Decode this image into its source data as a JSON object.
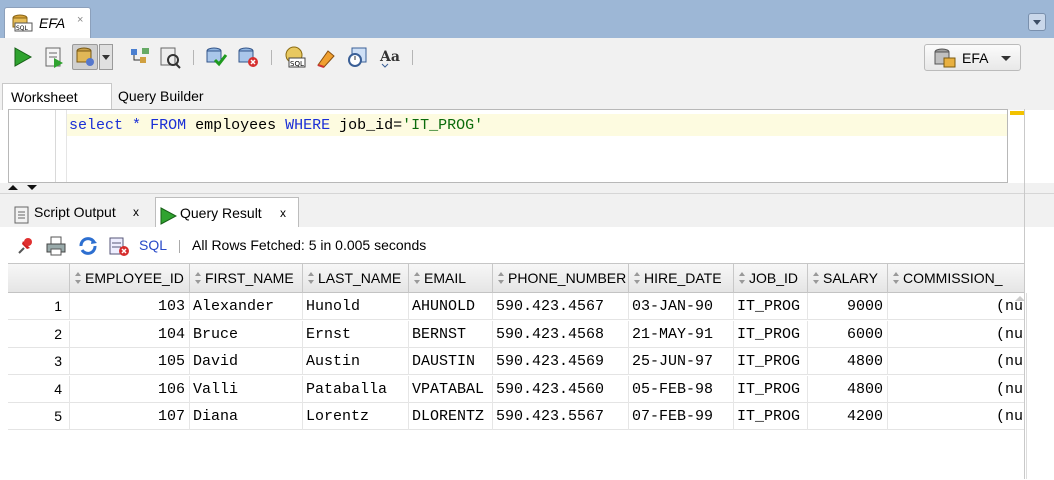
{
  "document_tab": {
    "title": "EFA",
    "close": "×",
    "icon": "sql-worksheet-icon"
  },
  "toolbar": {
    "connection_label": "EFA",
    "icons": [
      "run-statement-icon",
      "run-script-icon",
      "autotrace-icon",
      "dropdown-arrow-icon",
      "explain-plan-icon",
      "sql-tuning-icon",
      "commit-icon",
      "rollback-icon",
      "sql-history-icon",
      "clear-icon",
      "unshared-worksheet-icon",
      "format-case-icon"
    ]
  },
  "worksheet_tabs": {
    "worksheet": "Worksheet",
    "query_builder": "Query Builder"
  },
  "editor": {
    "tokens": [
      {
        "t": "select",
        "c": "kw"
      },
      {
        "t": " ",
        "c": ""
      },
      {
        "t": "*",
        "c": "kw"
      },
      {
        "t": " ",
        "c": ""
      },
      {
        "t": "FROM",
        "c": "kw"
      },
      {
        "t": " employees ",
        "c": ""
      },
      {
        "t": "WHERE",
        "c": "kw"
      },
      {
        "t": " job_id=",
        "c": ""
      },
      {
        "t": "'IT_PROG'",
        "c": "str"
      }
    ]
  },
  "output_tabs": {
    "script_output": "Script Output",
    "query_result": "Query Result",
    "close": "x"
  },
  "result_toolbar": {
    "sql_link": "SQL",
    "status": "All Rows Fetched: 5 in 0.005 seconds",
    "icons": [
      "pin-icon",
      "print-icon",
      "refresh-icon",
      "export-icon"
    ]
  },
  "grid": {
    "columns": [
      "EMPLOYEE_ID",
      "FIRST_NAME",
      "LAST_NAME",
      "EMAIL",
      "PHONE_NUMBER",
      "HIRE_DATE",
      "JOB_ID",
      "SALARY",
      "COMMISSION_"
    ],
    "rows": [
      {
        "n": "1",
        "cells": [
          "103",
          "Alexander",
          "Hunold",
          "AHUNOLD",
          "590.423.4567",
          "03-JAN-90",
          "IT_PROG",
          "9000",
          "(nu"
        ]
      },
      {
        "n": "2",
        "cells": [
          "104",
          "Bruce",
          "Ernst",
          "BERNST",
          "590.423.4568",
          "21-MAY-91",
          "IT_PROG",
          "6000",
          "(nu"
        ]
      },
      {
        "n": "3",
        "cells": [
          "105",
          "David",
          "Austin",
          "DAUSTIN",
          "590.423.4569",
          "25-JUN-97",
          "IT_PROG",
          "4800",
          "(nu"
        ]
      },
      {
        "n": "4",
        "cells": [
          "106",
          "Valli",
          "Pataballa",
          "VPATABAL",
          "590.423.4560",
          "05-FEB-98",
          "IT_PROG",
          "4800",
          "(nu"
        ]
      },
      {
        "n": "5",
        "cells": [
          "107",
          "Diana",
          "Lorentz",
          "DLORENTZ",
          "590.423.5567",
          "07-FEB-99",
          "IT_PROG",
          "4200",
          "(nu"
        ]
      }
    ]
  },
  "colors": {
    "tabstrip": "#9db7d6",
    "keyword": "#1a2fd6",
    "string": "#0b6b0b",
    "current_line": "#fdfbe0",
    "sql_link": "#2849c8"
  }
}
